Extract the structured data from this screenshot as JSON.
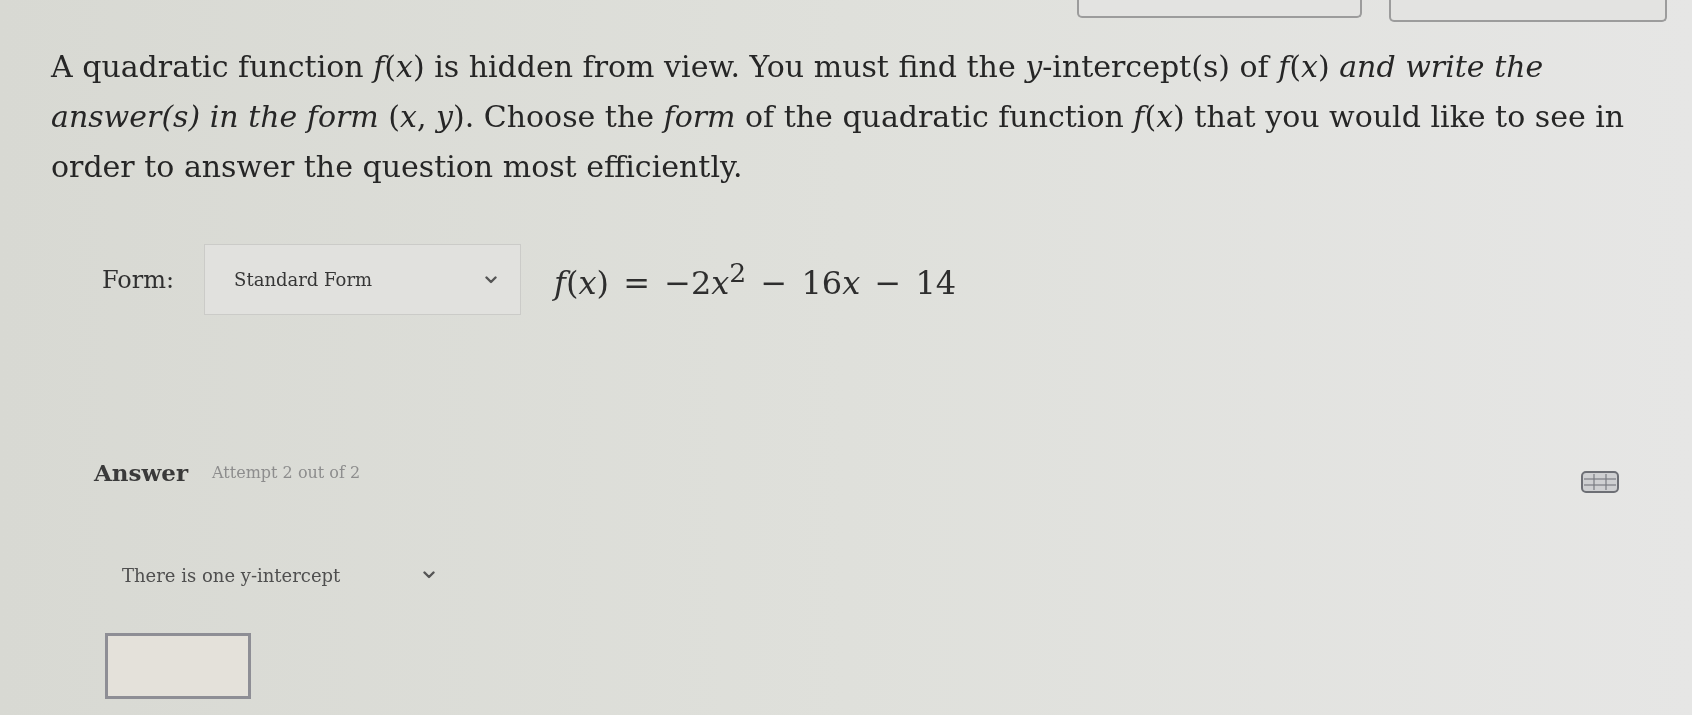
{
  "prompt": {
    "lines": [
      "A quadratic function *f*(*x*) is hidden from view. You must find the *y*-intercept(s) of *f*(*x*) *and write the*",
      "*answer(s) in the form* (*x*, *y*). Choose the *form* of the quadratic function *f*(*x*) that you would like to see in",
      "order to answer the question most efficiently."
    ]
  },
  "form_row": {
    "label": "Form:",
    "select": {
      "value": "Standard Form"
    },
    "equation": [
      "*f*(*x*) = −2",
      "*x*$^{2}$ − 16",
      "*x* − 14"
    ]
  },
  "answer": {
    "heading": "Answer",
    "attempt": "Attempt 2 out of 2",
    "intercept_select": {
      "value": "There is one y-intercept"
    }
  }
}
